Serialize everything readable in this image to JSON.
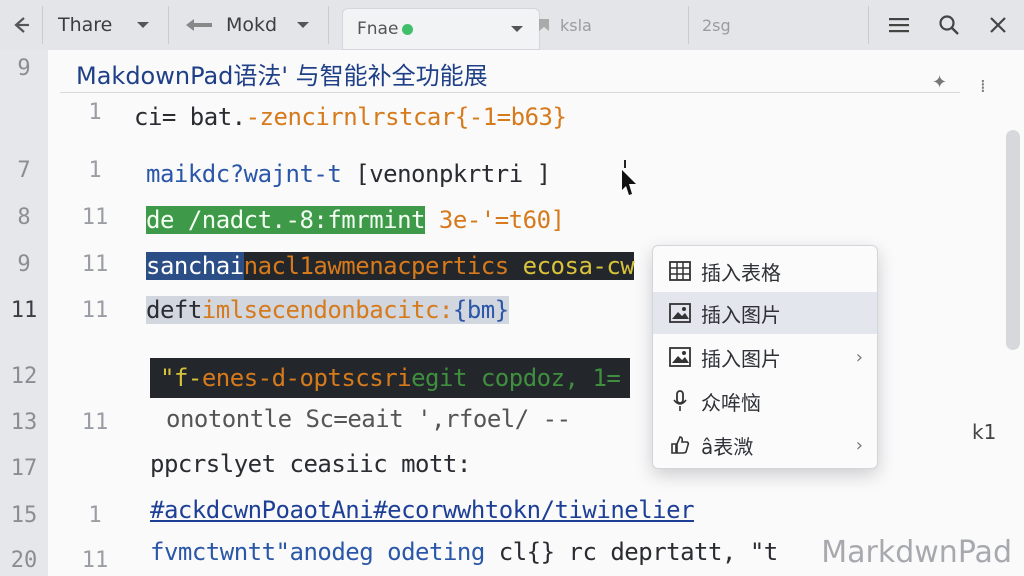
{
  "toolbar": {
    "back_icon": "arrow-left-icon",
    "share_label": "Thare",
    "mode_label": "Mokd",
    "tab_label": "Fnae",
    "faded_tab": "ksla",
    "search_hint": "2sg"
  },
  "document": {
    "title": "MakdownPad语法' 与智能补全功能展"
  },
  "gutter_numbers": [
    "9",
    "7",
    "8",
    "9",
    "11",
    "12",
    "13",
    "17",
    "15",
    "20"
  ],
  "inner_numbers": [
    "1",
    "1",
    "11",
    "11",
    "11",
    "11",
    "1",
    "11"
  ],
  "code_lines": {
    "l1_a": "ci= ",
    "l1_b": "bat.",
    "l1_c": "-zencirnlrstcar{-1=b63}",
    "l2_a": "maikdc?wajnt-t ",
    "l2_b": "[venonpkrtri ]",
    "l3_a": "de /nadct.-8:fmrmint",
    "l3_b": " 3e-'=t60]",
    "l4_a": "sanchai",
    "l4_b": "nacl1awmenacpertics",
    "l4_c": " ecosa-cw",
    "l5_a": "deft",
    "l5_b": "imlsecendonbacitc:",
    "l5_c": "{bm}",
    "l6_a": "\"f-",
    "l6_b": "enes-d-optscsri",
    "l6_c": "egit copdoz, 1=",
    "l7": "onotontle Sc=eait  ',rfoel/ --",
    "l8": "ppcrslyet  ceasiic mott:",
    "l9": "#ackdcwnPoaotAni#ecorwwhtokn/tiwinelier",
    "l10_a": "fvmctwntt\"",
    "l10_b": "anodeg odeting",
    "l10_c": " cl{} rc deprtatt, \"t"
  },
  "context_menu": {
    "items": [
      {
        "label": "插入表格",
        "icon": "table-icon",
        "submenu": false
      },
      {
        "label": "插入图片",
        "icon": "image-icon",
        "submenu": false,
        "selected": true
      },
      {
        "label": "插入图片",
        "icon": "image-icon",
        "submenu": true
      },
      {
        "label": "众哞恼",
        "icon": "microphone-icon",
        "submenu": false
      },
      {
        "label": "â表溦",
        "icon": "thumbs-up-icon",
        "submenu": true
      }
    ]
  },
  "side": {
    "right_label": "k1"
  },
  "watermark": "MarkdwnPad"
}
